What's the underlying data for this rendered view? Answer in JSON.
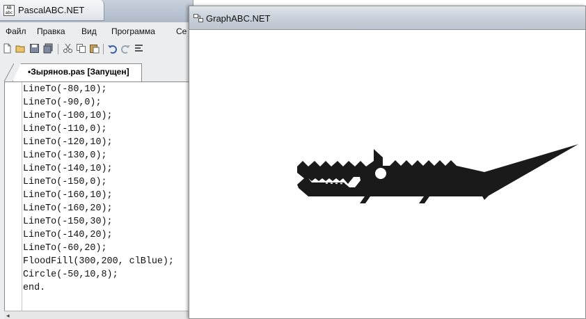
{
  "pascal_window": {
    "title": "PascalABC.NET",
    "icon_text": "AB abc",
    "menu": [
      {
        "label": "Файл"
      },
      {
        "label": "Правка"
      },
      {
        "label": "Вид"
      },
      {
        "label": "Программа"
      },
      {
        "label": "Се"
      }
    ],
    "toolbar_icons": [
      "new-file-icon",
      "open-folder-icon",
      "save-icon",
      "save-all-icon",
      "cut-icon",
      "copy-icon",
      "paste-icon",
      "undo-icon",
      "redo-icon",
      "format-icon"
    ],
    "file_tab_label": "•Зырянов.pas [Запущен]",
    "code_lines": [
      "LineTo(-80,10);",
      "LineTo(-90,0);",
      "LineTo(-100,10);",
      "LineTo(-110,0);",
      "LineTo(-120,10);",
      "LineTo(-130,0);",
      "LineTo(-140,10);",
      "LineTo(-150,0);",
      "LineTo(-160,10);",
      "LineTo(-160,20);",
      "LineTo(-150,30);",
      "LineTo(-140,20);",
      "LineTo(-60,20);",
      "FloodFill(300,200, clBlue);",
      "Circle(-50,10,8);",
      "end."
    ],
    "scroll_left_glyph": "◂"
  },
  "graph_window": {
    "title": "GraphABC.NET",
    "figure_color": "#1a1a1a",
    "canvas_color": "#ffffff"
  }
}
